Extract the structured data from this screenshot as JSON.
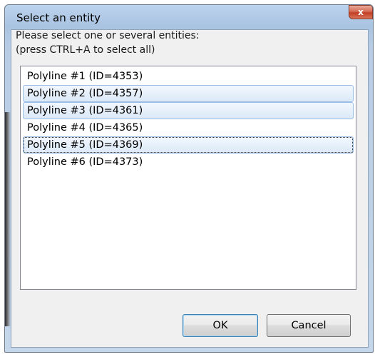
{
  "window": {
    "title": "Select an entity",
    "close_label": "x"
  },
  "prompt": {
    "line1": "Please select one or several entities:",
    "line2": "(press CTRL+A to select all)"
  },
  "list": {
    "items": [
      {
        "label": "Polyline #1 (ID=4353)",
        "selected": false,
        "focused": false
      },
      {
        "label": "Polyline #2 (ID=4357)",
        "selected": true,
        "focused": false
      },
      {
        "label": "Polyline #3 (ID=4361)",
        "selected": true,
        "focused": false
      },
      {
        "label": "Polyline #4 (ID=4365)",
        "selected": false,
        "focused": false
      },
      {
        "label": "Polyline #5 (ID=4369)",
        "selected": true,
        "focused": true
      },
      {
        "label": "Polyline #6 (ID=4373)",
        "selected": false,
        "focused": false
      }
    ]
  },
  "buttons": {
    "ok_label": "OK",
    "cancel_label": "Cancel"
  },
  "colors": {
    "selection_fill": "#dce9f8",
    "selection_border": "#99bde4",
    "close_button": "#c23d22"
  }
}
